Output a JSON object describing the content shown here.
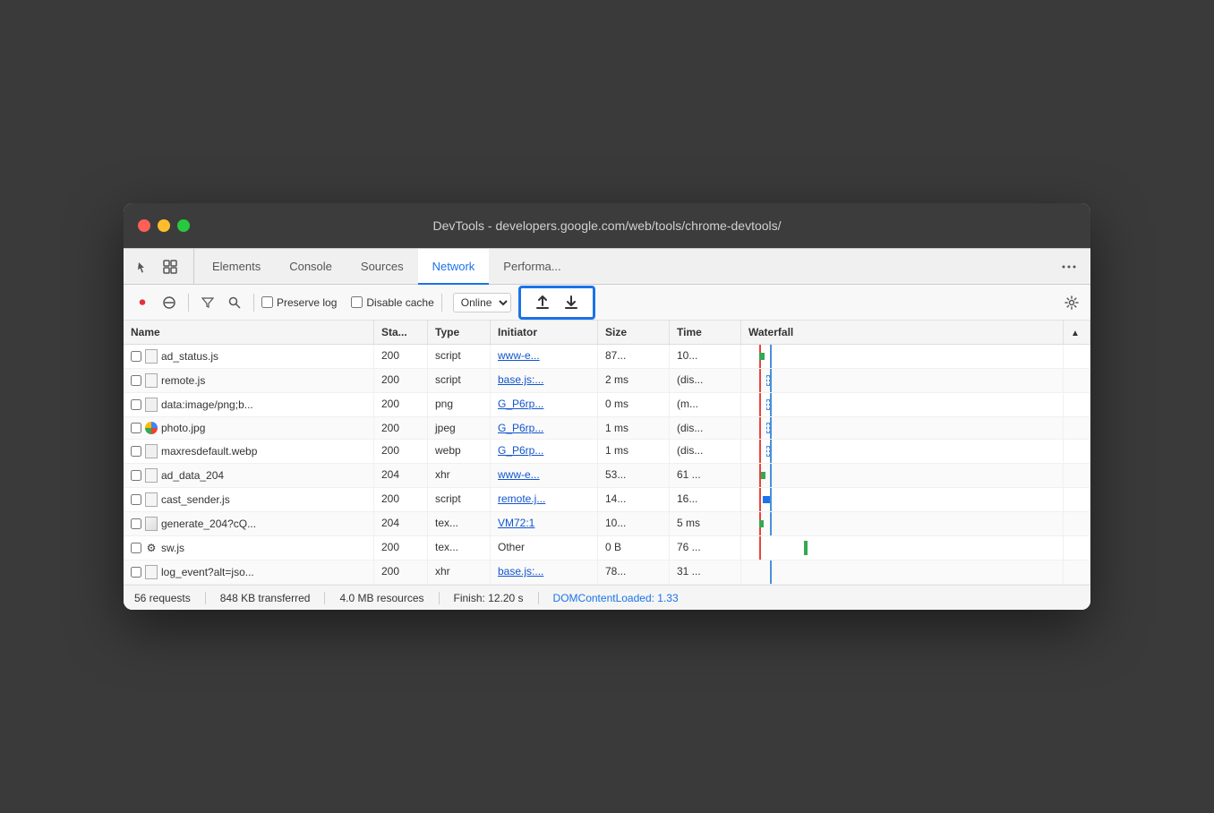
{
  "window": {
    "titlebar": "DevTools - developers.google.com/web/tools/chrome-devtools/"
  },
  "tabs": [
    {
      "id": "elements",
      "label": "Elements",
      "active": false
    },
    {
      "id": "console",
      "label": "Console",
      "active": false
    },
    {
      "id": "sources",
      "label": "Sources",
      "active": false
    },
    {
      "id": "network",
      "label": "Network",
      "active": true
    },
    {
      "id": "performance",
      "label": "Performa...",
      "active": false
    }
  ],
  "toolbar": {
    "preserve_log": "Preserve log",
    "disable_cache": "Disable cache",
    "online": "Online",
    "upload_label": "↑",
    "download_label": "↓"
  },
  "table": {
    "headers": [
      "Name",
      "Sta...",
      "Type",
      "Initiator",
      "Size",
      "Time",
      "Waterfall",
      ""
    ],
    "rows": [
      {
        "checkbox": false,
        "name": "ad_status.js",
        "type_icon": "js",
        "status": "200",
        "type": "script",
        "initiator": "www-e...",
        "size": "87...",
        "time": "10..."
      },
      {
        "checkbox": false,
        "name": "remote.js",
        "type_icon": "js",
        "status": "200",
        "type": "script",
        "initiator": "base.js:...",
        "size": "2 ms",
        "time": "(dis..."
      },
      {
        "checkbox": false,
        "name": "data:image/png;b...",
        "type_icon": "png",
        "status": "200",
        "type": "png",
        "initiator": "G_P6rp...",
        "size": "0 ms",
        "time": "(m..."
      },
      {
        "checkbox": false,
        "name": "photo.jpg",
        "type_icon": "jpg",
        "status": "200",
        "type": "jpeg",
        "initiator": "G_P6rp...",
        "size": "1 ms",
        "time": "(dis..."
      },
      {
        "checkbox": false,
        "name": "maxresdefault.webp",
        "type_icon": "webp",
        "status": "200",
        "type": "webp",
        "initiator": "G_P6rp...",
        "size": "1 ms",
        "time": "(dis..."
      },
      {
        "checkbox": false,
        "name": "ad_data_204",
        "type_icon": "js",
        "status": "204",
        "type": "xhr",
        "initiator": "www-e...",
        "size": "53...",
        "time": "61 ..."
      },
      {
        "checkbox": false,
        "name": "cast_sender.js",
        "type_icon": "js",
        "status": "200",
        "type": "script",
        "initiator": "remote.j...",
        "size": "14...",
        "time": "16..."
      },
      {
        "checkbox": false,
        "name": "generate_204?cQ...",
        "type_icon": "generate",
        "status": "204",
        "type": "tex...",
        "initiator": "VM72:1",
        "size": "10...",
        "time": "5 ms"
      },
      {
        "checkbox": false,
        "name": "sw.js",
        "type_icon": "gear",
        "status": "200",
        "type": "tex...",
        "initiator": "Other",
        "size": "0 B",
        "time": "76 ..."
      },
      {
        "checkbox": false,
        "name": "log_event?alt=jso...",
        "type_icon": "js",
        "status": "200",
        "type": "xhr",
        "initiator": "base.js:...",
        "size": "78...",
        "time": "31 ..."
      }
    ]
  },
  "statusbar": {
    "requests": "56 requests",
    "transferred": "848 KB transferred",
    "resources": "4.0 MB resources",
    "finish": "Finish: 12.20 s",
    "domcontent": "DOMContentLoaded: 1.33"
  }
}
